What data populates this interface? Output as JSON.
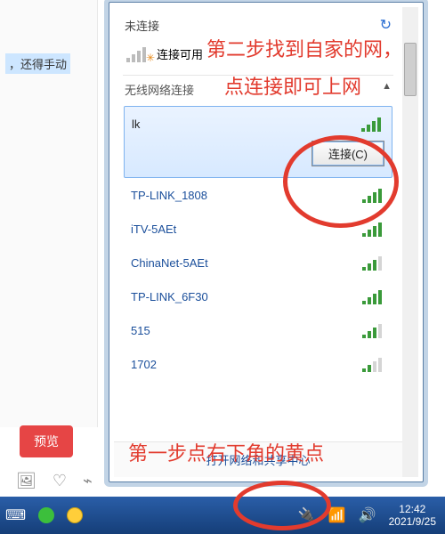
{
  "background": {
    "left_text": "，还得手动",
    "preview_label": "预览",
    "bottom_icons": [
      "image-icon",
      "heart-icon",
      "pulse-icon"
    ]
  },
  "flyout": {
    "header": "未连接",
    "available_label": "连接可用",
    "section_title": "无线网络连接",
    "connect_label": "连接(C)",
    "footer": "打开网络和共享中心",
    "networks": [
      {
        "name": "lk",
        "strength": 4,
        "selected": true
      },
      {
        "name": "TP-LINK_1808",
        "strength": 4,
        "selected": false
      },
      {
        "name": "iTV-5AEt",
        "strength": 4,
        "selected": false
      },
      {
        "name": "ChinaNet-5AEt",
        "strength": 3,
        "selected": false
      },
      {
        "name": "TP-LINK_6F30",
        "strength": 4,
        "selected": false
      },
      {
        "name": "515",
        "strength": 3,
        "selected": false
      },
      {
        "name": "1702",
        "strength": 2,
        "selected": false
      }
    ]
  },
  "taskbar": {
    "left_icons": [
      "keyboard-icon",
      "wechat-icon",
      "plus-icon"
    ],
    "tray_icons": [
      "power-icon",
      "network-icon",
      "volume-icon"
    ],
    "time": "12:42",
    "date": "2021/9/25"
  },
  "annotations": {
    "step2_line1": "第二步找到自家的网，",
    "step2_line2": "点连接即可上网",
    "step1": "第一步点右下角的黄点"
  }
}
